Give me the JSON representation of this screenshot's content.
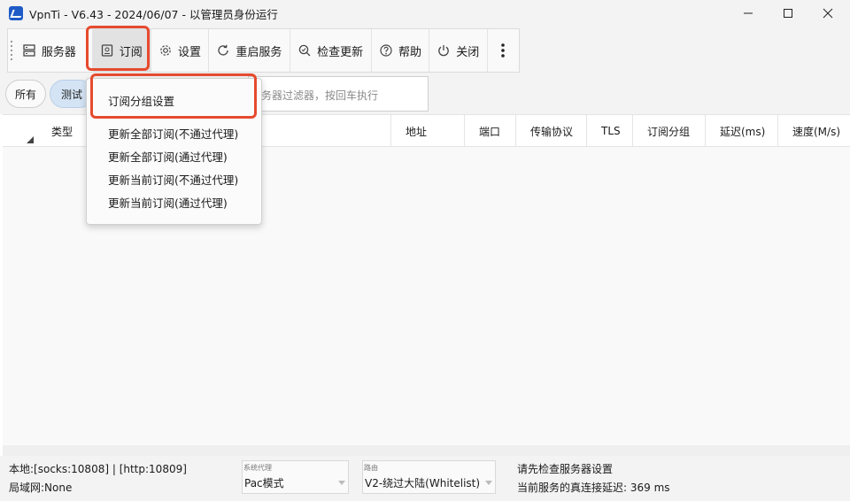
{
  "window": {
    "title": "VpnTi - V6.43 - 2024/06/07 - 以管理员身份运行",
    "controls": [
      "minimize-icon",
      "maximize-icon",
      "close-icon"
    ]
  },
  "toolbar": {
    "servers": "服务器",
    "subscription": "订阅",
    "settings": "设置",
    "restart": "重启服务",
    "check_update": "检查更新",
    "help": "帮助",
    "close": "关闭"
  },
  "filters": {
    "all": "所有",
    "test": "测试",
    "search_placeholder": "务器过滤器，按回车执行"
  },
  "table": {
    "columns": [
      "类型",
      "地址",
      "端口",
      "传输协议",
      "TLS",
      "订阅分组",
      "延迟(ms)",
      "速度(M/s)"
    ]
  },
  "subscription_menu": {
    "items": [
      "订阅分组设置",
      "更新全部订阅(不通过代理)",
      "更新全部订阅(通过代理)",
      "更新当前订阅(不通过代理)",
      "更新当前订阅(通过代理)"
    ]
  },
  "status": {
    "local": "本地:[socks:10808] | [http:10809]",
    "lan": "局域网:None",
    "proxy_label": "系统代理",
    "proxy_value": "Pac模式",
    "route_label": "路由",
    "route_value": "V2-绕过大陆(Whitelist)",
    "message": "请先检查服务器设置",
    "latency": "当前服务的真连接延迟: 369 ms"
  },
  "colors": {
    "highlight": "#e64a2e",
    "accent": "#1e5bc6",
    "selected_chip": "#d4e4f5"
  }
}
